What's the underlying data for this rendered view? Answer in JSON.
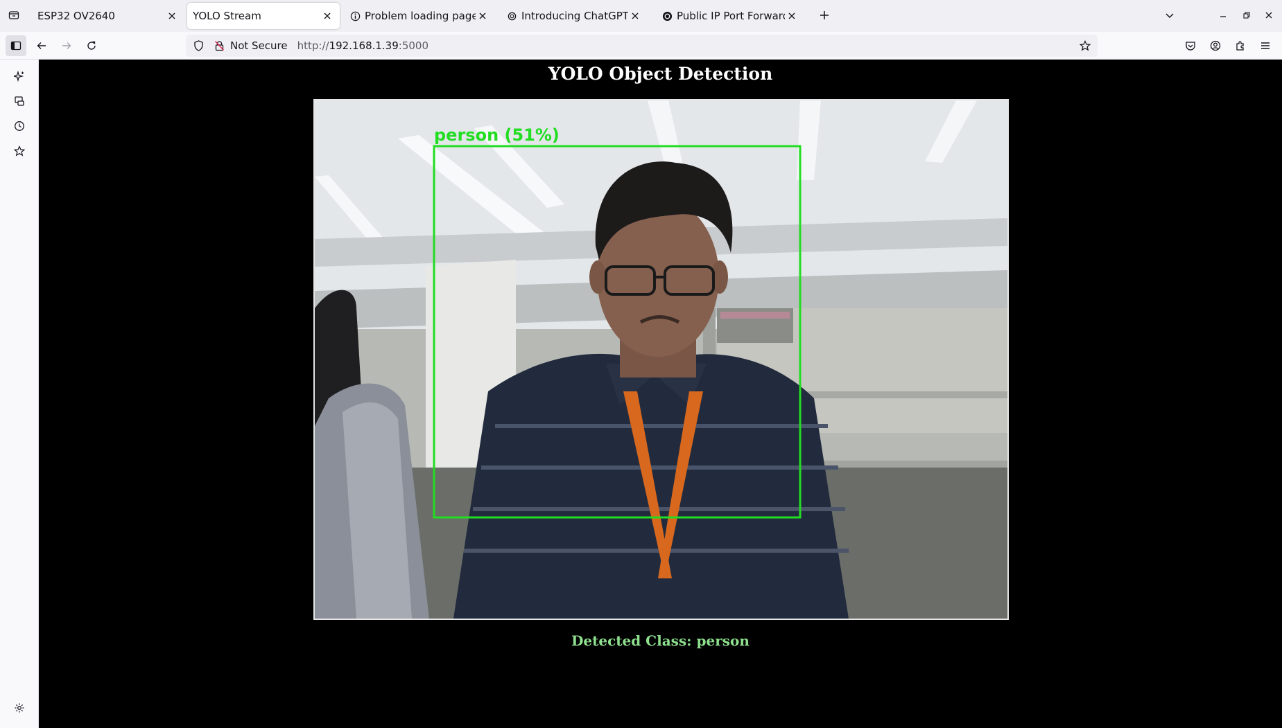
{
  "tabs": [
    {
      "title": "ESP32 OV2640",
      "active": false,
      "favicon": "none"
    },
    {
      "title": "YOLO Stream",
      "active": true,
      "favicon": "none"
    },
    {
      "title": "Problem loading page",
      "active": false,
      "favicon": "info-icon"
    },
    {
      "title": "Introducing ChatGPT | Op",
      "active": false,
      "favicon": "openai-icon"
    },
    {
      "title": "Public IP Port Forwarding",
      "active": false,
      "favicon": "openai-icon"
    }
  ],
  "navbar": {
    "security_label": "Not Secure",
    "url_scheme": "http://",
    "url_host": "192.168.1.39",
    "url_port": ":5000"
  },
  "page": {
    "title": "YOLO Object Detection",
    "detected_label": "Detected Class: person"
  },
  "detection": {
    "label": "person (51%)",
    "class": "person",
    "confidence_percent": 51,
    "box_color": "#22dd22"
  },
  "colors": {
    "page_background": "#000000",
    "title_text": "#ffffff",
    "detected_text": "#8fe08f"
  }
}
